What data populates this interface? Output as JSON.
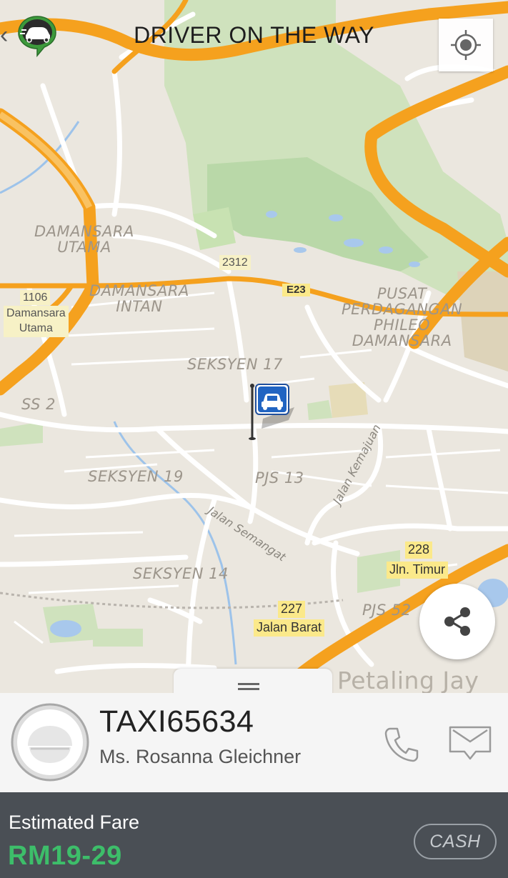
{
  "header": {
    "title": "DRIVER ON THE WAY",
    "logo_icon": "car-speech-bubble-icon",
    "locate_icon": "gps-target-icon"
  },
  "map": {
    "area_labels": {
      "damansara_utama": "DAMANSARA\nUTAMA",
      "damansara_intan": "DAMANSARA\nINTAN",
      "pusat": "PUSAT\nPERDAGANGAN\nPHILEO\nDAMANSARA",
      "seksyen17": "SEKSYEN 17",
      "ss2": "SS 2",
      "seksyen19": "SEKSYEN 19",
      "pjs13": "PJS 13",
      "seksyen14": "SEKSYEN 14",
      "pjs52": "PJS 52",
      "petaling": "Petaling Jay"
    },
    "road_labels": {
      "semangat": "Jalan Semangat",
      "kemajuan": "Jalan Kemajuan"
    },
    "shields": {
      "r2312": "2312",
      "e23": "E23",
      "r1106_num": "1106",
      "r1106_name": "Damansara\nUtama",
      "r228_num": "228",
      "r228_name": "Jln. Timur",
      "r227_num": "227",
      "r227_name": "Jalan Barat"
    }
  },
  "driver": {
    "plate": "TAXI65634",
    "name": "Ms. Rosanna Gleichner"
  },
  "fare": {
    "label": "Estimated Fare",
    "value": "RM19-29",
    "payment": "CASH"
  },
  "colors": {
    "fare_green": "#3dbe6a",
    "fare_panel": "#4a4f55",
    "highway_orange": "#f5a11e"
  }
}
